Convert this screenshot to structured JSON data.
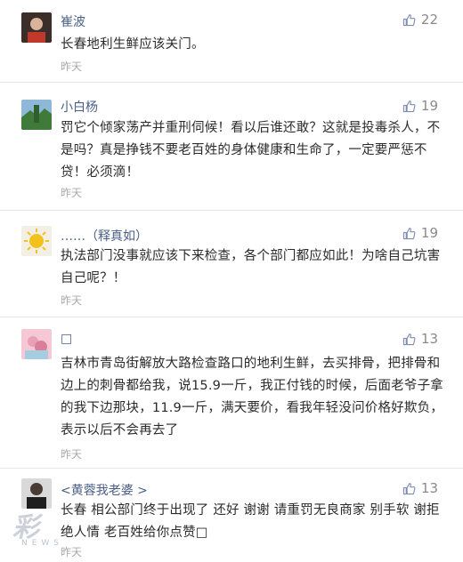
{
  "comments": [
    {
      "username": "崔波",
      "likes": "22",
      "text": "长春地利生鲜应该关门。",
      "time": "昨天"
    },
    {
      "username": "小白杨",
      "likes": "19",
      "text": "罚它个倾家荡产并重刑伺候！看以后谁还敢？这就是投毒杀人，不是吗？真是挣钱不要老百姓的身体健康和生命了，一定要严惩不贷！必须滴！",
      "time": "昨天"
    },
    {
      "username": "……（释真如）",
      "likes": "19",
      "text": "执法部门没事就应该下来检查，各个部门都应如此！为啥自己坑害自己呢？！",
      "time": "昨天"
    },
    {
      "username": "□",
      "likes": "13",
      "text": "吉林市青岛街解放大路检查路口的地利生鲜，去买排骨，把排骨和边上的刺骨都给我，说15.9一斤，我正付钱的时候，后面老爷子拿的我下边那块，11.9一斤，满天要价，看我年轻没问价格好欺负，表示以后不会再去了",
      "time": "昨天"
    },
    {
      "username": "<黄蓉我老婆 >",
      "likes": "13",
      "text": "长春 相公部门终于出现了 还好 谢谢 请重罚无良商家 别手软 谢拒绝人情 老百姓给你点赞□",
      "time": "昨天"
    }
  ],
  "watermark": {
    "glyph": "彩",
    "sub": "NEWS"
  },
  "colors": {
    "username": "#4a5f87",
    "text": "#2b2b2b",
    "meta": "#a9a9a9",
    "divider": "#e6e6e6"
  },
  "icons": {
    "like": "thumbs-up-icon"
  }
}
